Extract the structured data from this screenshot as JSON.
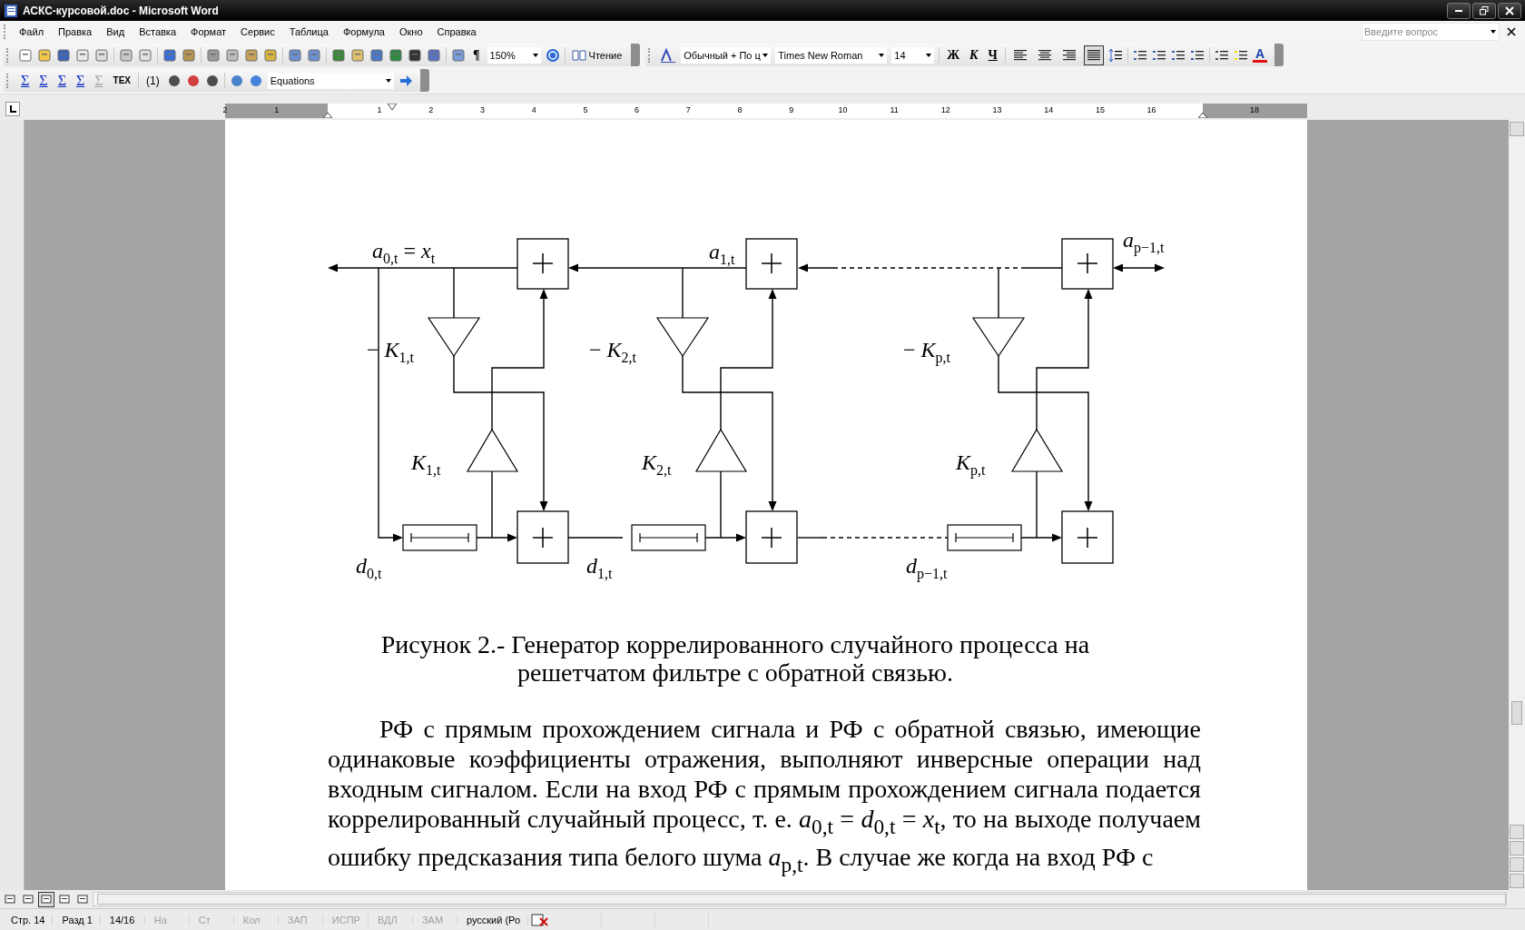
{
  "window": {
    "title": "АСКС-курсовой.doc - Microsoft Word"
  },
  "menu": [
    {
      "label": "Файл"
    },
    {
      "label": "Правка"
    },
    {
      "label": "Вид"
    },
    {
      "label": "Вставка"
    },
    {
      "label": "Формат"
    },
    {
      "label": "Сервис"
    },
    {
      "label": "Таблица"
    },
    {
      "label": "Формула"
    },
    {
      "label": "Окно"
    },
    {
      "label": "Справка"
    }
  ],
  "help_box": {
    "placeholder": "Введите вопрос"
  },
  "standard_toolbar": {
    "pilcrow": "¶",
    "zoom": "150%",
    "reading": "Чтение"
  },
  "formatting_toolbar": {
    "style": "Обычный + По ц",
    "font": "Times New Roman",
    "size": "14",
    "bold": "Ж",
    "italic": "К",
    "underline": "Ч",
    "font_color": "A",
    "alignment": [
      {
        "kind": "left",
        "selected": false
      },
      {
        "kind": "center",
        "selected": false
      },
      {
        "kind": "right",
        "selected": false
      },
      {
        "kind": "justify",
        "selected": true
      }
    ]
  },
  "equations_toolbar": {
    "sums": [
      {
        "label": "Σ",
        "disabled": false
      },
      {
        "label": "Σ",
        "disabled": false
      },
      {
        "label": "Σ",
        "disabled": false
      },
      {
        "label": "Σ",
        "disabled": false
      },
      {
        "label": "Σ",
        "disabled": true
      }
    ],
    "tex_button": "TEX",
    "number": "(1)",
    "style": "Equations"
  },
  "ruler": [
    "2",
    "1",
    "1",
    "2",
    "3",
    "4",
    "5",
    "6",
    "7",
    "8",
    "9",
    "10",
    "11",
    "12",
    "13",
    "14",
    "15",
    "16",
    "18"
  ],
  "diagram": {
    "labels": [
      "*a*$_{0,t}$ = *x*$_{t}$",
      "*a*$_{1,t}$",
      "*a*$_{p−1,t}$",
      "− *K*$_{1,t}$",
      "− *K*$_{2,t}$",
      "− *K*$_{p,t}$",
      "*K*$_{1,t}$",
      "*K*$_{2,t}$",
      "*K*$_{p,t}$",
      "*d*$_{0,t}$",
      "*d*$_{1,t}$",
      "*d*$_{p−1,t}$"
    ]
  },
  "caption": [
    "Рисунок 2.- Генератор коррелированного случайного процесса на",
    "решетчатом фильтре с обратной связью."
  ],
  "paragraph": "РФ с прямым прохождением сигнала и РФ с обратной связью, имеющие одинаковые коэффициенты отражения, выполняют инверсные операции над входным сигналом. Если на вход РФ с прямым прохождением сигнала подается коррелированный случайный процесс, т. е. *a*$_{0,t}$ = *d*$_{0,t}$ = *x*$_{t}$, то на выходе получаем ошибку предсказания типа белого шума *a*$_{p,t}$. В случае же когда на вход РФ с",
  "views": [
    {
      "selected": false
    },
    {
      "selected": false
    },
    {
      "selected": true
    },
    {
      "selected": false
    },
    {
      "selected": false
    }
  ],
  "status_bar": [
    {
      "text": "Стр. 14",
      "disabled": false
    },
    {
      "text": "Разд 1",
      "disabled": false
    },
    {
      "text": "14/16",
      "disabled": false
    },
    {
      "text": "На",
      "disabled": true
    },
    {
      "text": "Ст",
      "disabled": true
    },
    {
      "text": "Кол",
      "disabled": true
    },
    {
      "text": "ЗАП",
      "disabled": true
    },
    {
      "text": "ИСПР",
      "disabled": true
    },
    {
      "text": "ВДЛ",
      "disabled": true
    },
    {
      "text": "ЗАМ",
      "disabled": true
    },
    {
      "text": "русский (Ро",
      "disabled": false
    }
  ]
}
